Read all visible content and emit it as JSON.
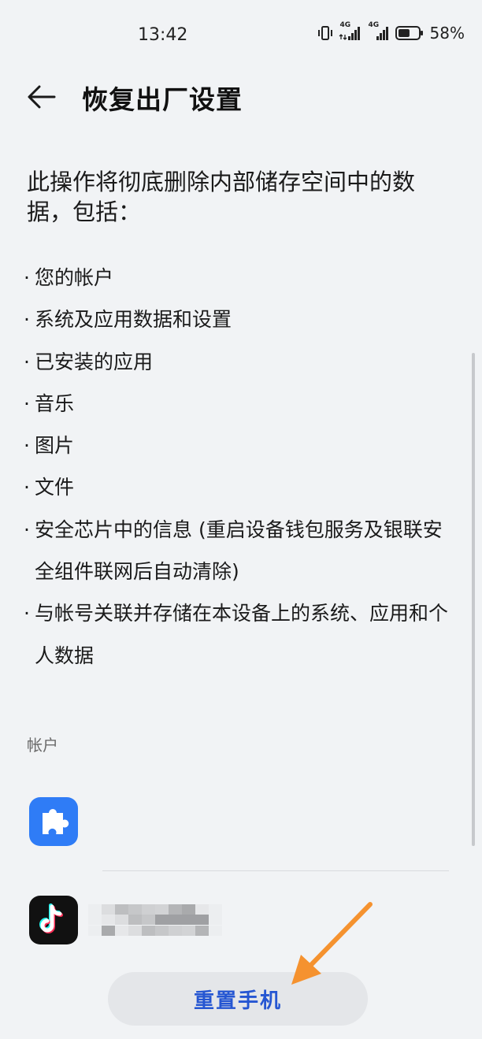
{
  "status_bar": {
    "time": "13:42",
    "signal_1_label": "4G",
    "signal_2_label": "4G",
    "battery_percent": "58%",
    "battery_level": 0.58
  },
  "header": {
    "title": "恢复出厂设置"
  },
  "intro": {
    "text": "此操作将彻底删除内部储存空间中的数据，包括："
  },
  "bullets": [
    "您的帐户",
    "系统及应用数据和设置",
    "已安装的应用",
    "音乐",
    "图片",
    "文件",
    "安全芯片中的信息 (重启设备钱包服务及银联安全组件联网后自动清除)",
    "与帐号关联并存储在本设备上的系统、应用和个人数据"
  ],
  "bullet_glyph": "·",
  "accounts": {
    "section_label": "帐户",
    "items": [
      {
        "icon": "puzzle-piece-icon",
        "icon_color": "#2f7cf6"
      },
      {
        "icon": "tiktok-icon",
        "icon_color": "#111111"
      }
    ]
  },
  "actions": {
    "reset_label": "重置手机"
  },
  "colors": {
    "background": "#f1f3f5",
    "accent": "#2556d2",
    "annotation_arrow": "#f5922f"
  }
}
